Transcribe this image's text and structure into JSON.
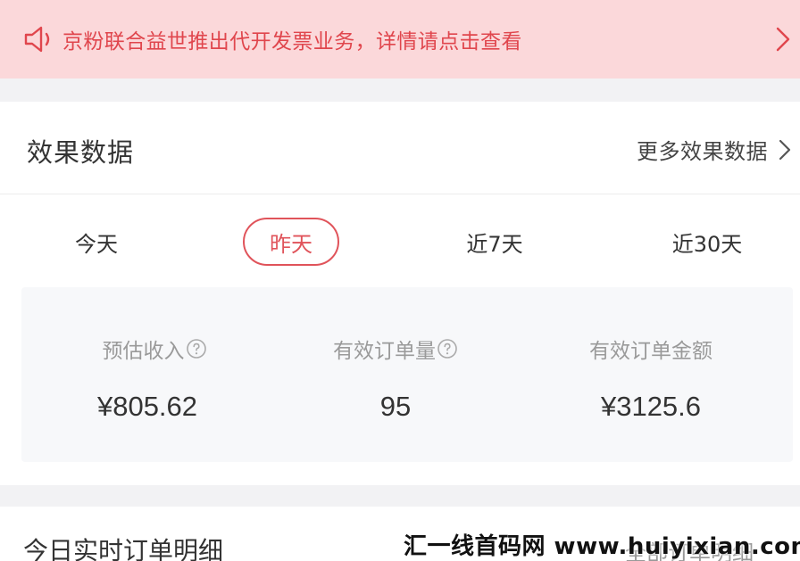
{
  "notice": {
    "text": "京粉联合益世推出代开发票业务，详情请点击查看",
    "icon": "speaker-icon",
    "accent": "#e0464d",
    "background": "#fbd8da"
  },
  "performance": {
    "title": "效果数据",
    "more_label": "更多效果数据",
    "tabs": [
      {
        "label": "今天",
        "selected": false
      },
      {
        "label": "昨天",
        "selected": true
      },
      {
        "label": "近7天",
        "selected": false
      },
      {
        "label": "近30天",
        "selected": false
      }
    ],
    "stats": [
      {
        "label": "预估收入",
        "value": "¥805.62",
        "has_help": true
      },
      {
        "label": "有效订单量",
        "value": "95",
        "has_help": true
      },
      {
        "label": "有效订单金额",
        "value": "¥3125.6",
        "has_help": false
      }
    ],
    "tab_accent": "#e0535a"
  },
  "realtime": {
    "title": "今日实时订单明细",
    "right_label": "全部订单明细"
  },
  "watermark": "汇一线首码网 www.huiyixian.com"
}
